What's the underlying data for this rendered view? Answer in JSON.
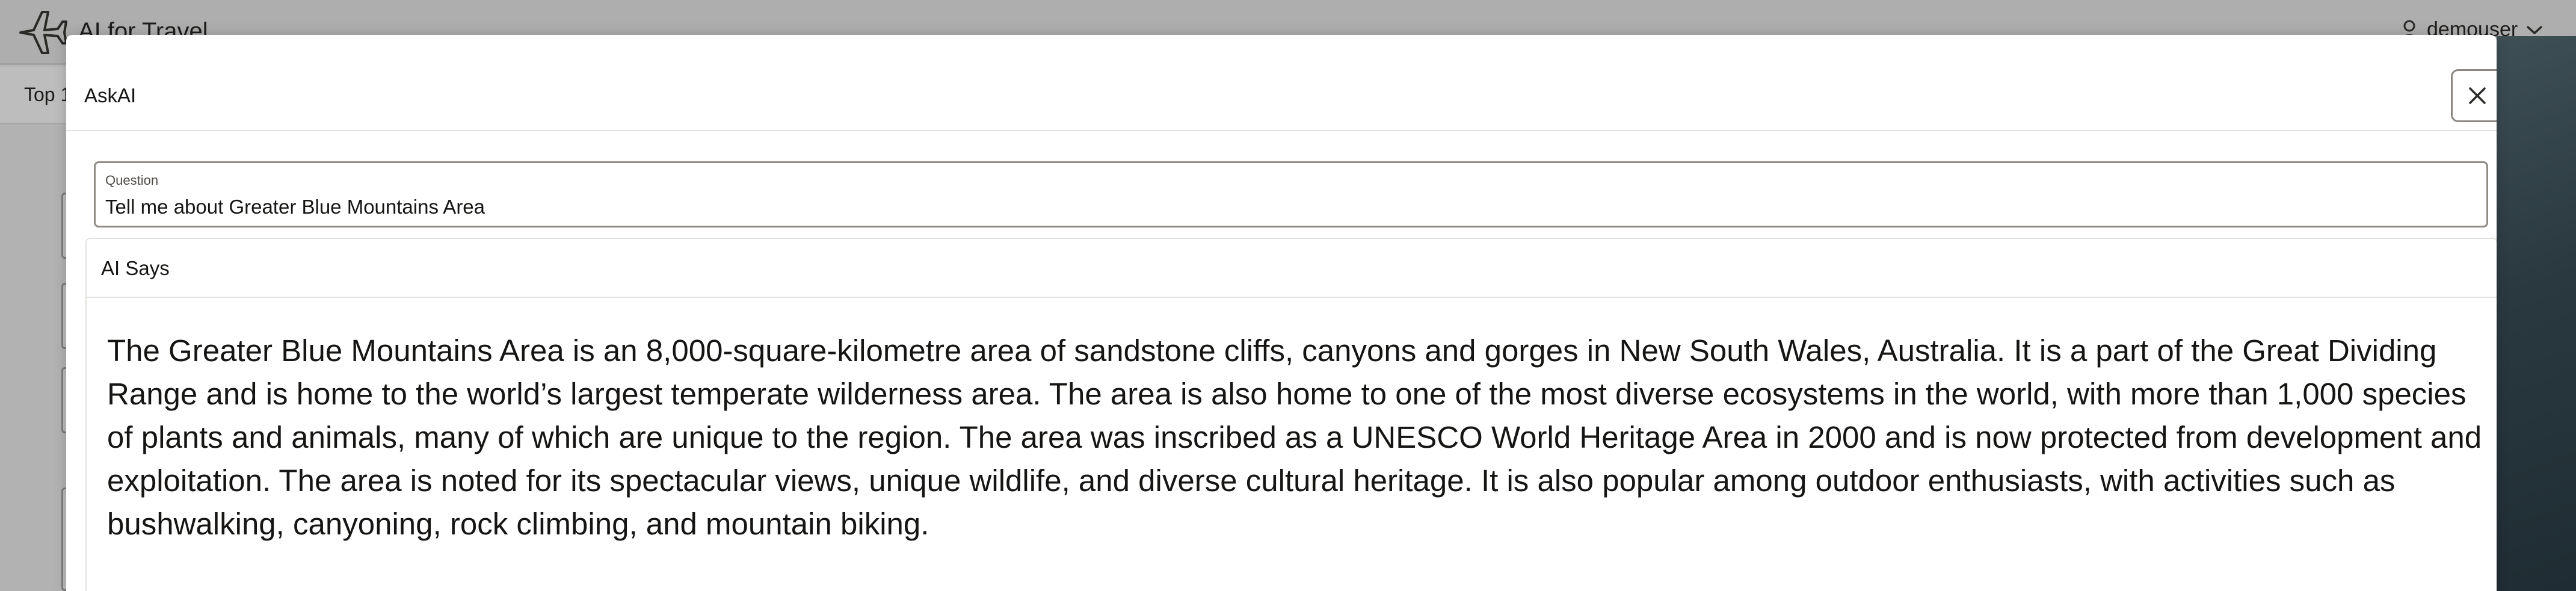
{
  "app": {
    "title": "AI for Travel",
    "logo_icon": "airplane-icon",
    "user": {
      "name": "demouser",
      "icon": "person-icon",
      "chevron": "chevron-down-icon"
    },
    "subbar": {
      "tab_label": "Top 1"
    }
  },
  "dialog": {
    "title": "AskAI",
    "close_icon": "close-icon",
    "question": {
      "label": "Question",
      "value": "Tell me about Greater Blue Mountains Area"
    },
    "answer": {
      "header": "AI Says",
      "text": "The Greater Blue Mountains Area is an 8,000-square-kilometre area of sandstone cliffs, canyons and gorges in New South Wales, Australia. It is a part of the Great Dividing Range and is home to the world’s largest temperate wilderness area. The area is also home to one of the most diverse ecosystems in the world, with more than 1,000 species of plants and animals, many of which are unique to the region. The area was inscribed as a UNESCO World Heritage Area in 2000 and is now protected from development and exploitation. The area is noted for its spectacular views, unique wildlife, and diverse cultural heritage. It is also popular among outdoor enthusiasts, with activities such as bushwalking, canyoning, rock climbing, and mountain biking."
    }
  },
  "colors": {
    "overlay_background": "#b5b5b5",
    "dialog_background": "#ffffff",
    "text": "#161513",
    "border": "#e4e1dd"
  }
}
